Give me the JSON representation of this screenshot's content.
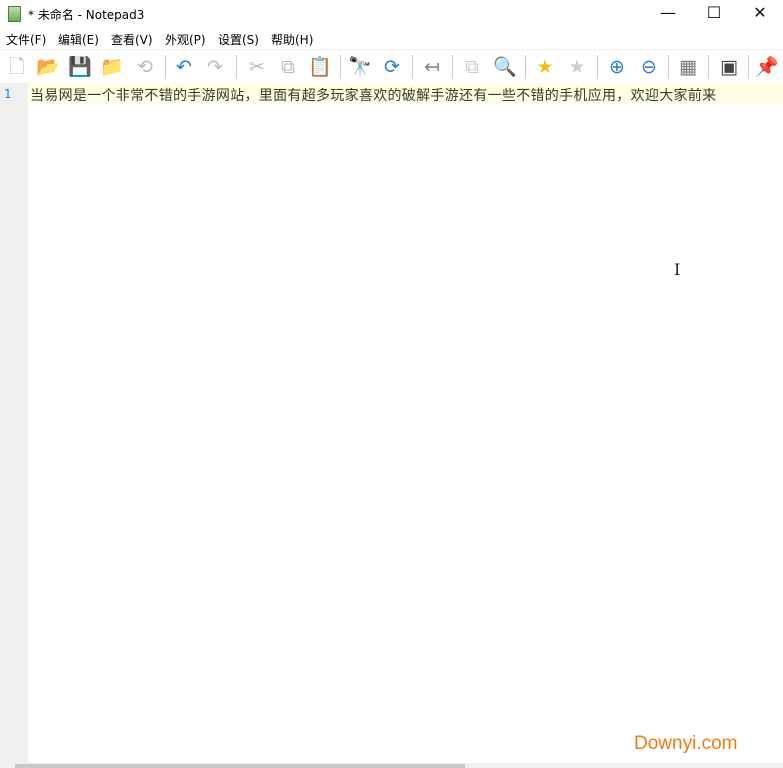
{
  "window": {
    "title": "* 未命名 - Notepad3",
    "minimize": "—",
    "maximize": "☐",
    "close": "✕"
  },
  "menu": [
    "文件(F)",
    "编辑(E)",
    "查看(V)",
    "外观(P)",
    "设置(S)",
    "帮助(H)"
  ],
  "toolbar": [
    {
      "name": "new-file",
      "glyph": "🗋",
      "color": "#bbb"
    },
    {
      "name": "open-folder",
      "glyph": "📂",
      "color": "#e8b040"
    },
    {
      "name": "save",
      "glyph": "💾",
      "color": "#8a5ab0"
    },
    {
      "name": "save-as",
      "glyph": "📁",
      "color": "#d8a840"
    },
    {
      "name": "revert",
      "glyph": "⟲",
      "color": "#bbb"
    },
    {
      "name": "undo",
      "glyph": "↶",
      "color": "#2c7fd0"
    },
    {
      "name": "redo",
      "glyph": "↷",
      "color": "#bbb"
    },
    {
      "name": "cut",
      "glyph": "✂",
      "color": "#bbb"
    },
    {
      "name": "copy",
      "glyph": "⧉",
      "color": "#bbb"
    },
    {
      "name": "paste",
      "glyph": "📋",
      "color": "#666"
    },
    {
      "name": "find",
      "glyph": "🔭",
      "color": "#444"
    },
    {
      "name": "replace",
      "glyph": "⟳",
      "color": "#2c7fd0"
    },
    {
      "name": "word-wrap",
      "glyph": "↤",
      "color": "#888"
    },
    {
      "name": "schema",
      "glyph": "⧉",
      "color": "#ccc"
    },
    {
      "name": "find-region",
      "glyph": "🔍",
      "color": "#2c7fd0"
    },
    {
      "name": "favorite",
      "glyph": "★",
      "color": "#e8c020"
    },
    {
      "name": "add-favorite",
      "glyph": "★",
      "color": "#ccc"
    },
    {
      "name": "zoom-in",
      "glyph": "⊕",
      "color": "#2c7fd0"
    },
    {
      "name": "zoom-out",
      "glyph": "⊖",
      "color": "#2c7fd0"
    },
    {
      "name": "keyboard",
      "glyph": "▦",
      "color": "#777"
    },
    {
      "name": "terminal",
      "glyph": "▣",
      "color": "#444"
    },
    {
      "name": "pin",
      "glyph": "📌",
      "color": "#2c7fd0"
    }
  ],
  "editor": {
    "line_number": "1",
    "line_text": "当易网是一个非常不错的手游网站，里面有超多玩家喜欢的破解手游还有一些不错的手机应用，欢迎大家前来"
  },
  "watermark": "Downyi.com"
}
